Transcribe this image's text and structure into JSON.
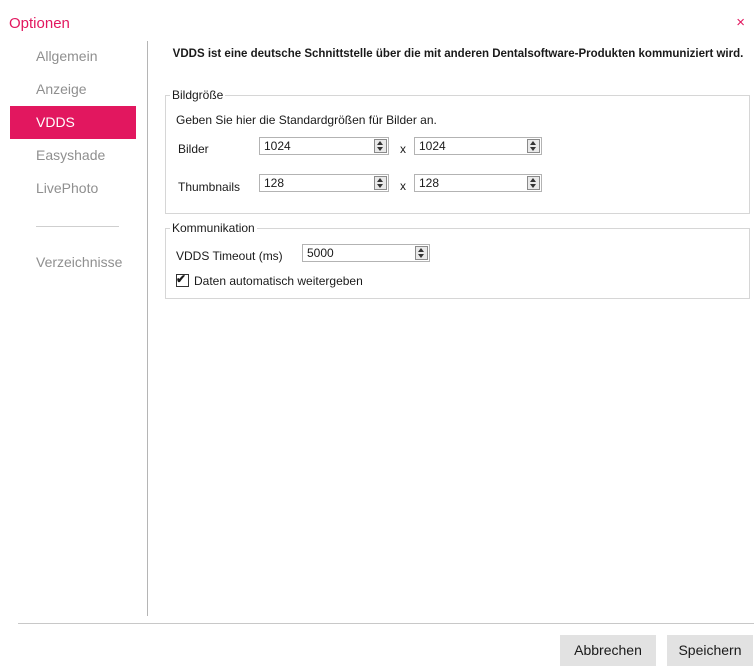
{
  "window": {
    "title": "Optionen",
    "close_glyph": "×"
  },
  "sidebar": {
    "items": [
      {
        "label": "Allgemein"
      },
      {
        "label": "Anzeige"
      },
      {
        "label": "VDDS"
      },
      {
        "label": "Easyshade"
      },
      {
        "label": "LivePhoto"
      },
      {
        "label": "Verzeichnisse"
      }
    ],
    "active": "VDDS"
  },
  "main": {
    "heading": "VDDS ist eine deutsche Schnittstelle über die mit anderen Dentalsoftware-Produkten kommuniziert wird.",
    "image_size": {
      "legend": "Bildgröße",
      "description": "Geben Sie hier die Standardgrößen für Bilder an.",
      "separator": "x",
      "rows": [
        {
          "label": "Bilder",
          "width": "1024",
          "height": "1024"
        },
        {
          "label": "Thumbnails",
          "width": "128",
          "height": "128"
        }
      ]
    },
    "communication": {
      "legend": "Kommunikation",
      "timeout_label": "VDDS Timeout (ms)",
      "timeout_value": "5000",
      "auto_forward_label": "Daten automatisch weitergeben",
      "auto_forward_checked": true
    }
  },
  "footer": {
    "cancel_label": "Abbrechen",
    "save_label": "Speichern"
  },
  "colors": {
    "accent": "#e2175f",
    "inactive_text": "#8f8f8f",
    "button_bg": "#e2e2e2"
  }
}
